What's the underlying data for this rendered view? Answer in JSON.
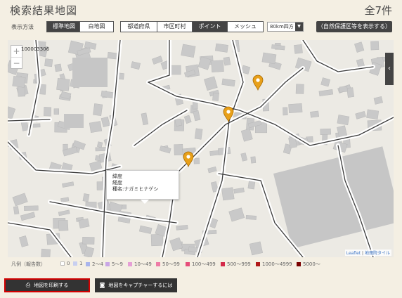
{
  "header": {
    "title": "検索結果地図",
    "count": "全7件"
  },
  "toolbar": {
    "display_label": "表示方法",
    "map_type": [
      {
        "label": "標準地図",
        "active": true
      },
      {
        "label": "白地図",
        "active": false
      }
    ],
    "level": [
      {
        "label": "都道府県",
        "active": false
      },
      {
        "label": "市区町村",
        "active": false
      },
      {
        "label": "ポイント",
        "active": true
      },
      {
        "label": "メッシュ",
        "active": false
      }
    ],
    "mesh_select": "80km四方",
    "protected_areas_button": "（自然保護区等を表示する）"
  },
  "map": {
    "zoom_in": "+",
    "zoom_out": "−",
    "mesh_code": "100003306",
    "panel_toggle": "‹",
    "marker_icon": "map-pin-icon",
    "popup": {
      "lat": "緯度",
      "lng": "経度",
      "species": "種名:ナガミヒナゲシ"
    },
    "attribution": {
      "leaflet": "Leaflet",
      "sep": " | ",
      "source": "地理院タイル"
    }
  },
  "legend": {
    "title": "凡例（報告数）",
    "items": [
      {
        "label": "0",
        "color": "#ffffff"
      },
      {
        "label": "1",
        "color": "#c8cff0"
      },
      {
        "label": "2〜4",
        "color": "#a9b4ec"
      },
      {
        "label": "5〜9",
        "color": "#c9a6e6"
      },
      {
        "label": "10〜49",
        "color": "#e69fd6"
      },
      {
        "label": "50〜99",
        "color": "#ee7ca6"
      },
      {
        "label": "100〜499",
        "color": "#e64d7a"
      },
      {
        "label": "500〜999",
        "color": "#d42a4a"
      },
      {
        "label": "1000〜4999",
        "color": "#b01818"
      },
      {
        "label": "5000〜",
        "color": "#7a0000"
      }
    ]
  },
  "actions": {
    "print": "地図を印刷する",
    "capture": "地図をキャプチャーするには",
    "print_icon": "printer-icon",
    "capture_icon": "camera-icon"
  }
}
